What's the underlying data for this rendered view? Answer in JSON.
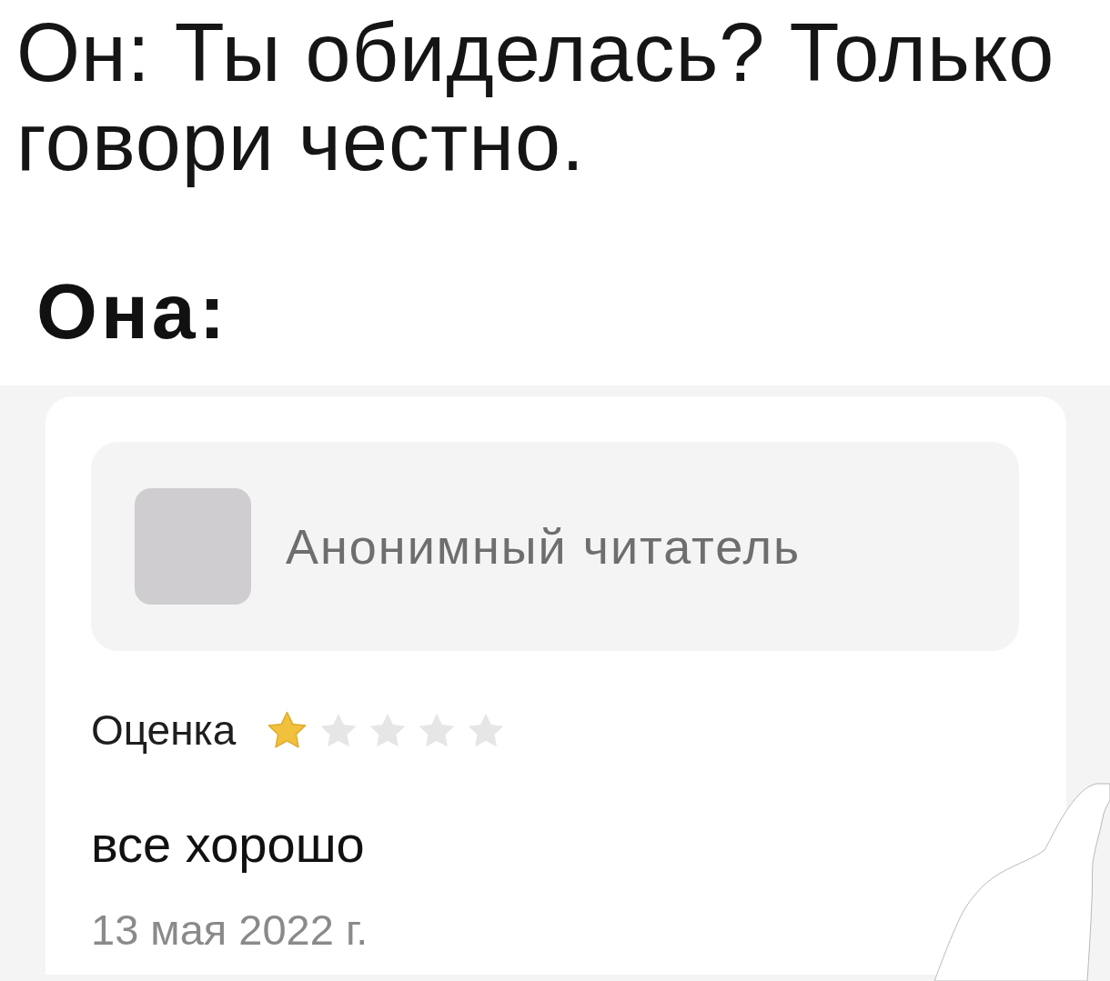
{
  "caption": "Он: Ты обиделась? Только говори честно.",
  "speaker": "Она:",
  "review": {
    "author": "Анонимный читатель",
    "rating_label": "Оценка",
    "stars": 1,
    "text": "все хорошо",
    "date": "13 мая 2022 г."
  }
}
